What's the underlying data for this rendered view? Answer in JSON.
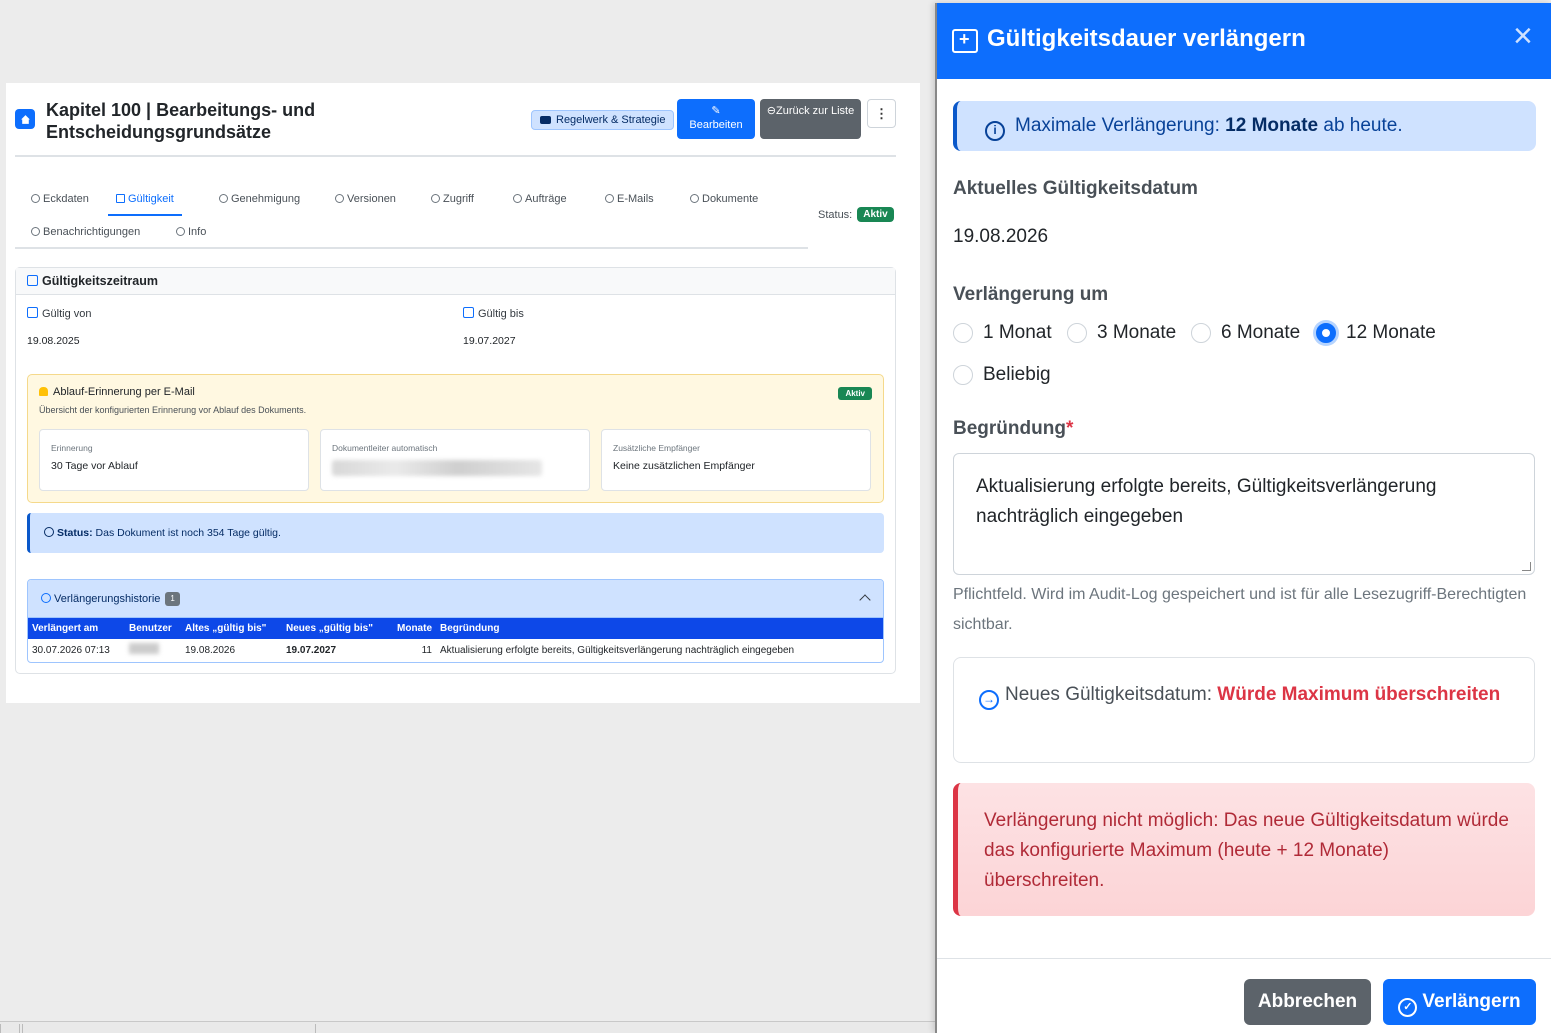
{
  "header": {
    "title": "Kapitel 100 | Bearbeitungs- und Entscheidungsgrundsätze",
    "category_badge": "Regelwerk & Strategie",
    "edit_button": "Bearbeiten",
    "back_button": "Zurück zur Liste",
    "more_button": "⋮"
  },
  "tabs": [
    {
      "label": "Eckdaten"
    },
    {
      "label": "Gültigkeit"
    },
    {
      "label": "Genehmigung"
    },
    {
      "label": "Versionen"
    },
    {
      "label": "Zugriff"
    },
    {
      "label": "Aufträge"
    },
    {
      "label": "E-Mails"
    },
    {
      "label": "Dokumente"
    },
    {
      "label": "Benachrichtigungen"
    },
    {
      "label": "Info"
    }
  ],
  "status": {
    "label": "Status:",
    "value": "Aktiv"
  },
  "validity": {
    "section_title": "Gültigkeitszeitraum",
    "from_label": "Gültig von",
    "from_value": "19.08.2025",
    "to_label": "Gültig bis",
    "to_value": "19.07.2027"
  },
  "reminder": {
    "title": "Ablauf-Erinnerung per E-Mail",
    "subtitle": "Übersicht der konfigurierten Erinnerung vor Ablauf des Dokuments.",
    "badge": "Aktiv",
    "box1_label": "Erinnerung",
    "box1_value": "30 Tage vor Ablauf",
    "box2_label": "Dokumentleiter automatisch",
    "box3_label": "Zusätzliche Empfänger",
    "box3_value": "Keine zusätzlichen Empfänger"
  },
  "status_info": {
    "label": "Status:",
    "text": "Das Dokument ist noch 354 Tage gültig."
  },
  "history": {
    "title": "Verlängerungshistorie",
    "count": "1",
    "columns": [
      "Verlängert am",
      "Benutzer",
      "Altes „gültig bis\"",
      "Neues „gültig bis\"",
      "Monate",
      "Begründung"
    ],
    "rows": [
      {
        "date": "30.07.2026 07:13",
        "old": "19.08.2026",
        "new": "19.07.2027",
        "months": "11",
        "reason": "Aktualisierung erfolgte bereits, Gültigkeitsverlängerung nachträglich eingegeben"
      }
    ]
  },
  "modal": {
    "title": "Gültigkeitsdauer verlängern",
    "close": "×",
    "info_prefix": "Maximale Verlängerung:",
    "info_bold": "12 Monate",
    "info_suffix": "ab heute.",
    "current_label": "Aktuelles Gültigkeitsdatum",
    "current_value": "19.08.2026",
    "extend_label": "Verlängerung um",
    "options": [
      "1 Monat",
      "3 Monate",
      "6 Monate",
      "12 Monate",
      "Beliebig"
    ],
    "selected_option": "12 Monate",
    "reason_label": "Begründung",
    "reason_required": "*",
    "reason_value": "Aktualisierung erfolgte bereits, Gültigkeitsverlängerung nachträglich eingegeben",
    "reason_help": "Pflichtfeld. Wird im Audit-Log gespeichert und ist für alle Lesezugriff-Berechtigten sichtbar.",
    "new_date_label": "Neues Gültigkeitsdatum:",
    "new_date_value": "Würde Maximum überschreiten",
    "error": "Verlängerung nicht möglich: Das neue Gültigkeitsdatum würde das konfigurierte Maximum (heute + 12 Monate) überschreiten.",
    "cancel_button": "Abbrechen",
    "submit_button": "Verlängern"
  },
  "colors": {
    "primary": "#0d6efd",
    "success": "#198754",
    "danger": "#dc3545",
    "secondary": "#5c636a"
  }
}
